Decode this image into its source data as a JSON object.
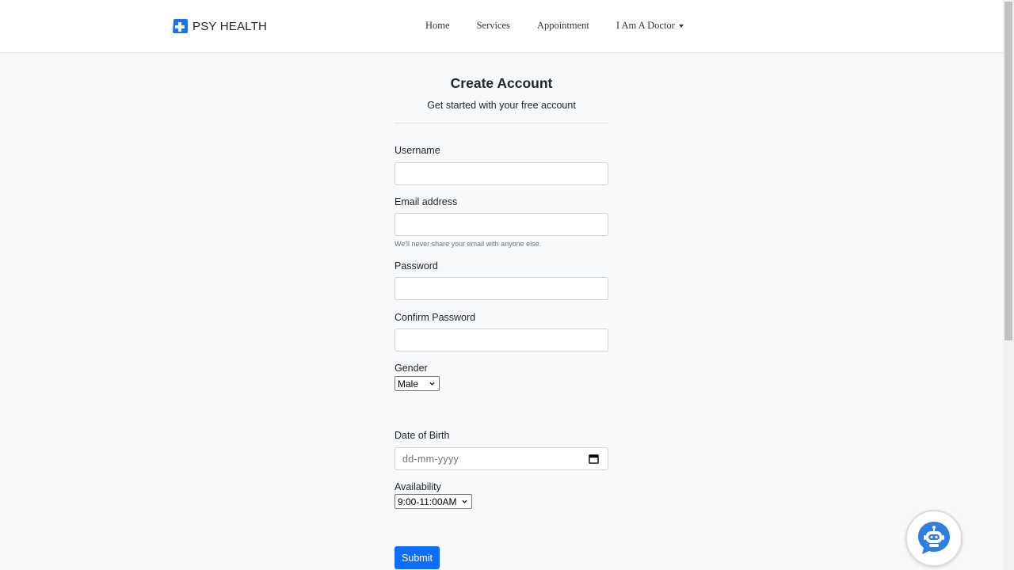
{
  "brand": {
    "name": "PSY HEALTH",
    "logo_icon": "medical-cross-icon",
    "accent": "#1a73e8"
  },
  "nav": {
    "home": "Home",
    "services": "Services",
    "appointment": "Appointment",
    "doctor": "I Am A Doctor"
  },
  "form": {
    "title": "Create Account",
    "subtitle": "Get started with your free account",
    "username_label": "Username",
    "email_label": "Email address",
    "email_help": "We'll never share your email with anyone else.",
    "password_label": "Password",
    "confirm_label": "Confirm Password",
    "gender_label": "Gender",
    "gender_value": "Male",
    "dob_label": "Date of Birth",
    "dob_placeholder": "dd-mm-yyyy",
    "availability_label": "Availability",
    "availability_value": "9:00-11:00AM",
    "submit_label": "Submit"
  },
  "chatbot": {
    "icon": "chatbot-icon",
    "color": "#2f7fe0"
  },
  "colors": {
    "primary": "#0d6efd",
    "background": "#f8f9fa"
  }
}
